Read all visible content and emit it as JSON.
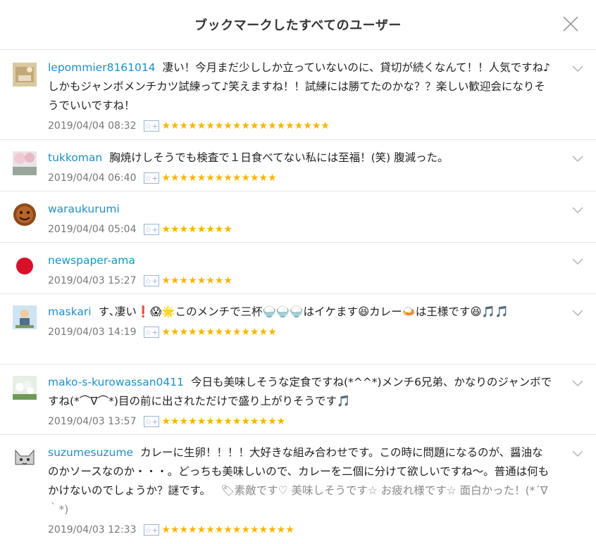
{
  "header": {
    "title": "ブックマークしたすべてのユーザー"
  },
  "rows": [
    {
      "user": "lepommier8161014",
      "comment": "凄い！今月まだ少ししか立っていないのに、貸切が続くなんて！！人気ですね♪しかもジャンボメンチカツ試練って♪笑えますね！！試練には勝てたのかな？？楽しい歓迎会になりそうでいいですね！",
      "tags": "",
      "time": "2019/04/04 08:32",
      "stars": "★★★★★★★★★★★★★★★★★★★",
      "star_count": 19
    },
    {
      "user": "tukkoman",
      "comment": "胸焼けしそうでも検査で１日食べてない私には至福！(笑) 腹減った。",
      "tags": "",
      "time": "2019/04/04 06:40",
      "stars": "★★★★★★★★★★★★★",
      "star_count": 13
    },
    {
      "user": "waraukurumi",
      "comment": "",
      "tags": "",
      "time": "2019/04/04 05:04",
      "stars": "★★★★★★★★",
      "star_count": 8
    },
    {
      "user": "newspaper-ama",
      "comment": "",
      "tags": "",
      "time": "2019/04/03 15:27",
      "stars": "★★★★★★★★",
      "star_count": 8
    },
    {
      "user": "maskari",
      "comment": "す､凄い❗😱🌟このメンチで三杯🍚🍚🍚はイケます😆カレー🍛は王様です😆🎵🎵",
      "tags": "",
      "time": "2019/04/03 14:19",
      "stars": "★★★★★★★★★★★★★",
      "star_count": 13
    },
    {
      "user": "mako-s-kurowassan0411",
      "comment": "今日も美味しそうな定食ですね(*^^*)メンチ6兄弟、かなりのジャンボですね(*⌒∇⌒*)目の前に出されただけで盛り上がりそうです🎵",
      "tags": "",
      "time": "2019/04/03 13:57",
      "stars": "★★★★★★★★★★★★★★",
      "star_count": 14
    },
    {
      "user": "suzumesuzume",
      "comment": "カレーに生卵！！！！大好きな組み合わせです。この時に問題になるのが、醤油なのかソースなのか・・・。どっちも美味しいので、カレーを二個に分けて欲しいですね～。普通は何もかけないのでしょうか？謎です。",
      "tags": "🏷素敵です♡ 美味しそうです☆ お疲れ様です☆ 面白かった！(*´∇｀*)",
      "time": "2019/04/03 12:33",
      "stars": "★★★★★★★★★★★★★★★",
      "star_count": 15
    }
  ],
  "icons": {
    "close": "close-icon",
    "chevron": "chevron-down-icon",
    "star_add": "add-star-icon",
    "tag": "tag-icon"
  },
  "colors": {
    "username": "#1f8fc4",
    "star": "#f7b500",
    "time": "#777777",
    "tags": "#8a8a8a"
  }
}
